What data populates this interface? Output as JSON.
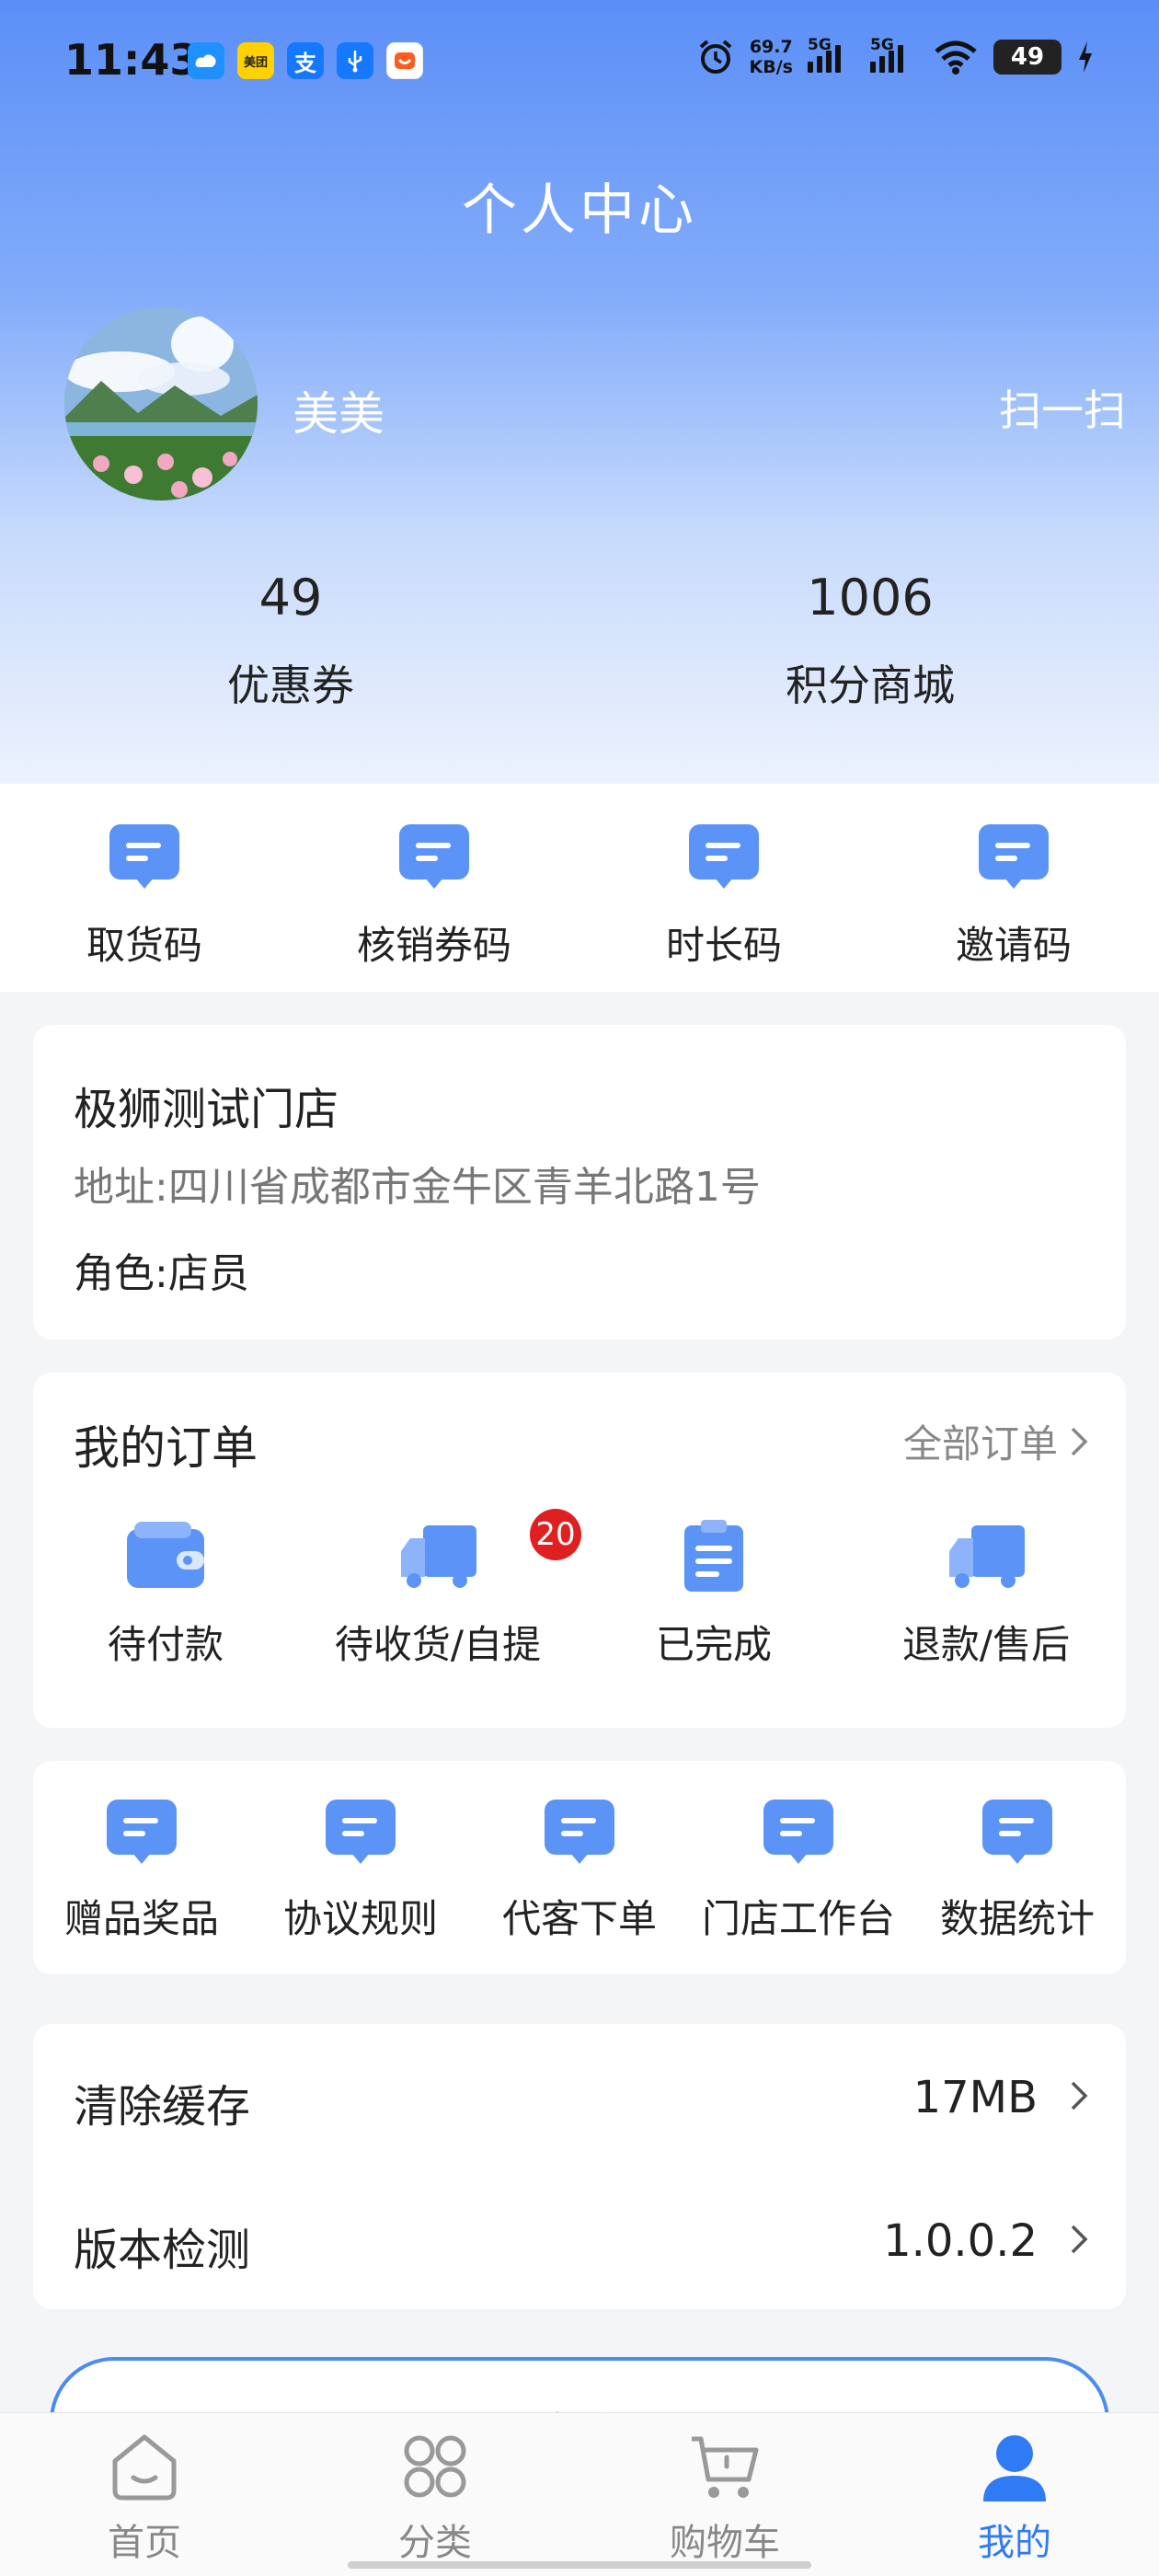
{
  "status_bar": {
    "time": "11:43",
    "notifications": [
      "",
      "美团",
      "支",
      "",
      ""
    ],
    "net_speed_value": "69.7",
    "net_speed_unit": "KB/s",
    "signal_1": "5G",
    "signal_2": "5G",
    "battery": "49"
  },
  "header": {
    "title": "个人中心"
  },
  "profile": {
    "username": "美美",
    "scan_label": "扫一扫"
  },
  "stats": [
    {
      "value": "49",
      "label": "优惠券"
    },
    {
      "value": "1006",
      "label": "积分商城"
    }
  ],
  "quick_codes": [
    {
      "label": "取货码",
      "icon": "chat-icon"
    },
    {
      "label": "核销券码",
      "icon": "chat-icon"
    },
    {
      "label": "时长码",
      "icon": "chat-icon"
    },
    {
      "label": "邀请码",
      "icon": "chat-icon"
    }
  ],
  "store": {
    "name": "极狮测试门店",
    "address": "地址:四川省成都市金牛区青羊北路1号",
    "role": "角色:店员"
  },
  "orders": {
    "title": "我的订单",
    "all_label": "全部订单",
    "items": [
      {
        "label": "待付款",
        "icon": "wallet-icon"
      },
      {
        "label": "待收货/自提",
        "icon": "truck-icon",
        "badge": "20"
      },
      {
        "label": "已完成",
        "icon": "clipboard-icon"
      },
      {
        "label": "退款/售后",
        "icon": "truck-icon"
      }
    ]
  },
  "tools": [
    {
      "label": "赠品奖品",
      "icon": "chat-icon"
    },
    {
      "label": "协议规则",
      "icon": "chat-icon"
    },
    {
      "label": "代客下单",
      "icon": "chat-icon"
    },
    {
      "label": "门店工作台",
      "icon": "chat-icon"
    },
    {
      "label": "数据统计",
      "icon": "chat-icon"
    }
  ],
  "settings": [
    {
      "label": "清除缓存",
      "value": "17MB"
    },
    {
      "label": "版本检测",
      "value": "1.0.0.2"
    }
  ],
  "logout_label": "退出登录",
  "tabbar": [
    {
      "label": "首页",
      "icon": "home-icon",
      "active": false
    },
    {
      "label": "分类",
      "icon": "category-icon",
      "active": false
    },
    {
      "label": "购物车",
      "icon": "cart-icon",
      "active": false
    },
    {
      "label": "我的",
      "icon": "user-icon",
      "active": true
    }
  ],
  "colors": {
    "accent": "#2f7af5",
    "icon_blue": "#5b93f7",
    "badge": "#e02020"
  }
}
